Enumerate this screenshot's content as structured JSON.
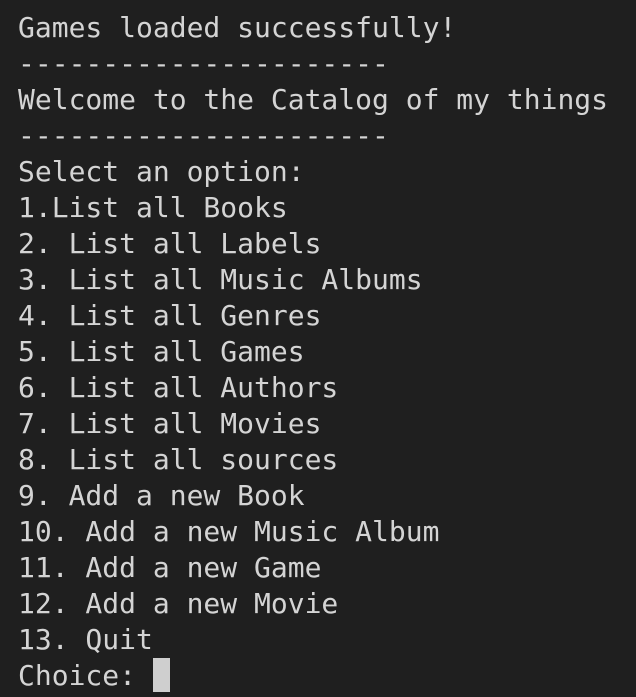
{
  "terminal": {
    "status": "Games loaded successfully!",
    "separator": "----------------------",
    "welcome": "Welcome to the Catalog of my things",
    "prompt": "Select an option:",
    "options": [
      "1.List all Books",
      "2. List all Labels",
      "3. List all Music Albums",
      "4. List all Genres",
      "5. List all Games",
      "6. List all Authors",
      "7. List all Movies",
      "8. List all sources",
      "9. Add a new Book",
      "10. Add a new Music Album",
      "11. Add a new Game",
      "12. Add a new Movie",
      "13. Quit"
    ],
    "choice_label": "Choice: ",
    "cursor_icon": "block-cursor",
    "colors": {
      "background": "#1f1f1f",
      "text": "#d4d4d4",
      "cursor": "#cfcfcf"
    }
  }
}
